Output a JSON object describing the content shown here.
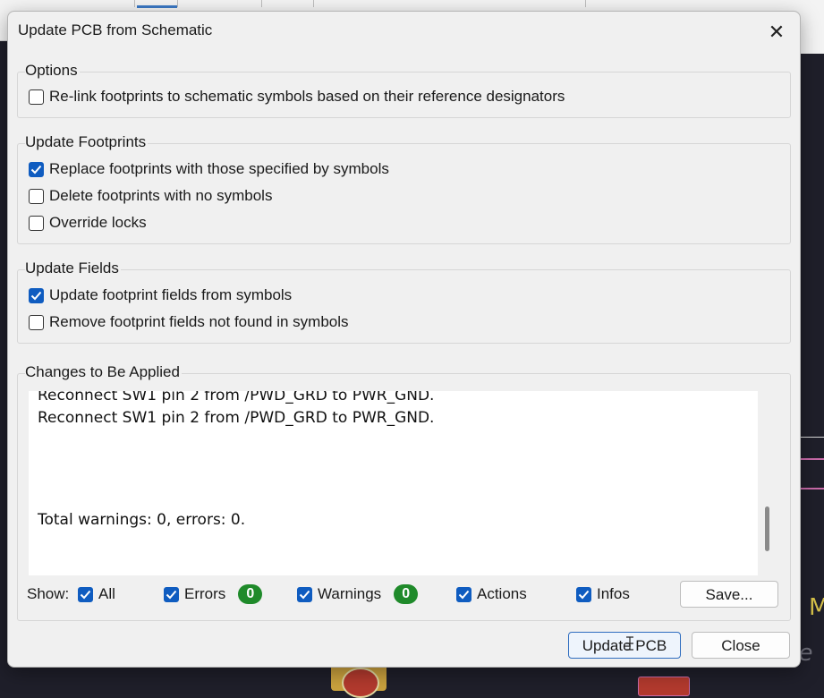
{
  "dialog": {
    "title": "Update PCB from Schematic",
    "close_icon": "close-icon"
  },
  "options": {
    "label": "Options",
    "items": [
      {
        "label": "Re-link footprints to schematic symbols based on their reference designators",
        "checked": false
      }
    ]
  },
  "update_footprints": {
    "label": "Update Footprints",
    "items": [
      {
        "label": "Replace footprints with those specified by symbols",
        "checked": true
      },
      {
        "label": "Delete footprints with no symbols",
        "checked": false
      },
      {
        "label": "Override locks",
        "checked": false
      }
    ]
  },
  "update_fields": {
    "label": "Update Fields",
    "items": [
      {
        "label": "Update footprint fields from symbols",
        "checked": true
      },
      {
        "label": "Remove footprint fields not found in symbols",
        "checked": false
      }
    ]
  },
  "changes": {
    "label": "Changes to Be Applied",
    "lines": [
      "Reconnect SW1 pin 2 from /PWD_GRD to PWR_GND.",
      "Reconnect SW1 pin 2 from /PWD_GRD to PWR_GND.",
      "Total warnings: 0, errors: 0."
    ]
  },
  "show": {
    "label": "Show:",
    "all": "All",
    "errors": "Errors",
    "errors_count": "0",
    "warnings": "Warnings",
    "warnings_count": "0",
    "actions": "Actions",
    "infos": "Infos",
    "save_button": "Save..."
  },
  "buttons": {
    "update": "Update PCB",
    "close": "Close"
  },
  "colors": {
    "checkbox_accent": "#0f5cc0",
    "badge_green": "#1f8a2a"
  }
}
